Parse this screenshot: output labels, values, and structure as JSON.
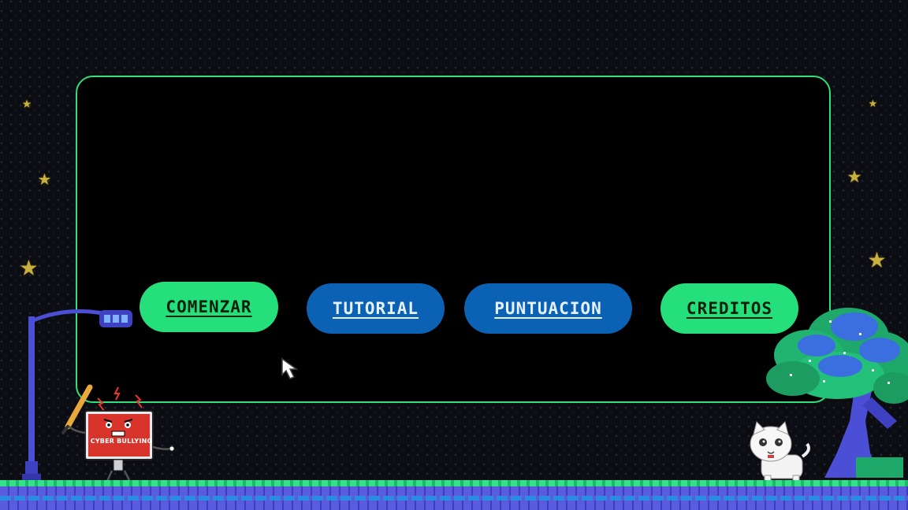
{
  "menu": {
    "comenzar": "COMENZAR",
    "tutorial": "TUTORIAL",
    "puntuacion": "PUNTUACION",
    "creditos": "CREDITOS"
  },
  "character": {
    "screen_label": "CYBER BULLYING"
  },
  "colors": {
    "panel_border": "#2fe07c",
    "button_green": "#25e07a",
    "button_blue": "#0b62b5",
    "background": "#0c0d12",
    "star": "#c9b13f"
  },
  "icons": [
    "star-icon",
    "cursor-icon",
    "street-lamp-icon",
    "tree-icon",
    "cat-icon",
    "computer-character-icon"
  ]
}
